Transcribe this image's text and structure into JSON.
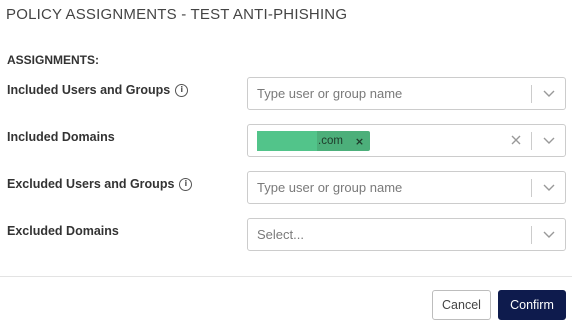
{
  "dialog": {
    "title": "POLICY ASSIGNMENTS - TEST ANTI-PHISHING",
    "section_label": "ASSIGNMENTS:"
  },
  "rows": [
    {
      "label": "Included Users and Groups",
      "has_info": true,
      "placeholder": "Type user or group name"
    },
    {
      "label": "Included Domains",
      "has_info": false,
      "chip_text": ".com",
      "chip_remove": "×"
    },
    {
      "label": "Excluded Users and Groups",
      "has_info": true,
      "placeholder": "Type user or group name"
    },
    {
      "label": "Excluded Domains",
      "has_info": false,
      "placeholder": "Select..."
    }
  ],
  "icons": {
    "info": "info-icon",
    "dropdown": "chevron-down-icon",
    "clear": "clear-icon"
  },
  "footer": {
    "cancel_label": "Cancel",
    "confirm_label": "Confirm"
  },
  "colors": {
    "confirm_bg": "#0e1b4d",
    "chip_bg": "#4caf7a",
    "border": "#cccccc"
  }
}
